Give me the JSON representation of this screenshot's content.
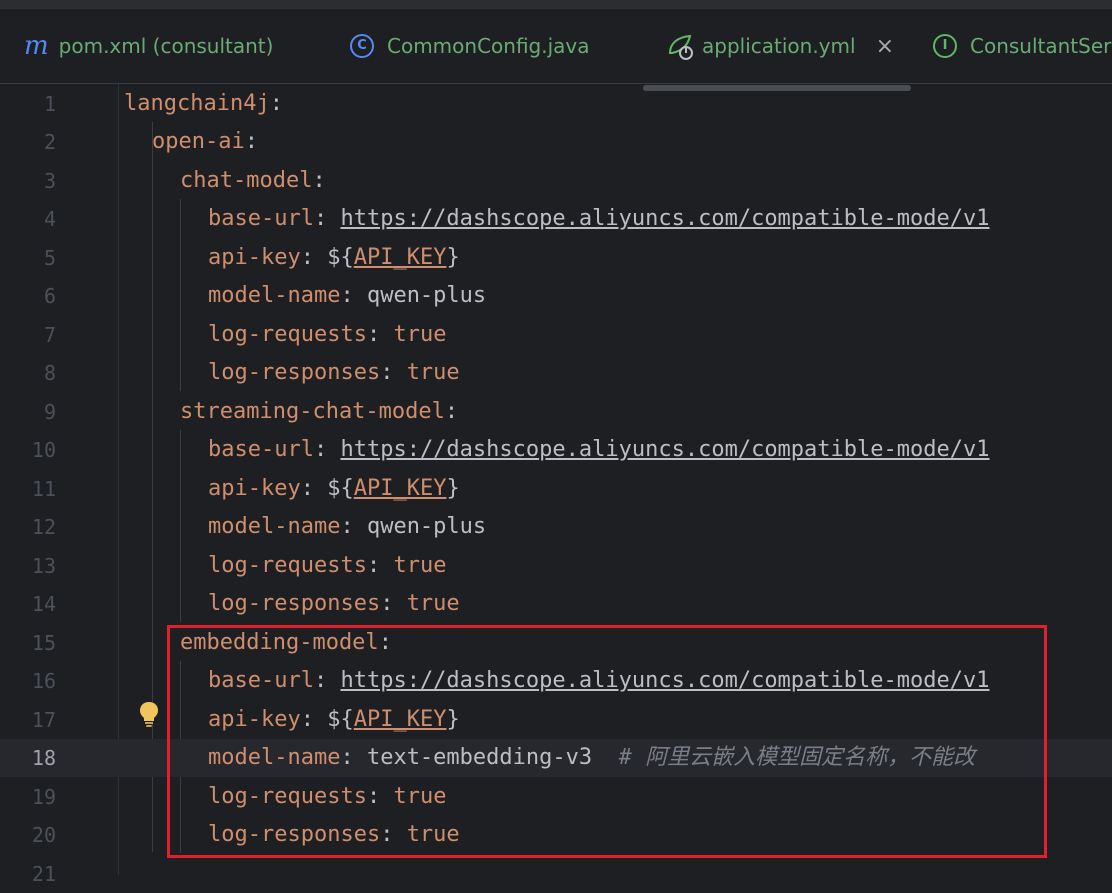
{
  "tabs": [
    {
      "label": "pom.xml (consultant)",
      "icon": "maven-m-icon"
    },
    {
      "label": "CommonConfig.java",
      "icon": "class-c-icon"
    },
    {
      "label": "application.yml",
      "icon": "spring-config-icon",
      "active": true,
      "close": "×"
    },
    {
      "label": "ConsultantService",
      "icon": "interface-i-icon"
    }
  ],
  "editor": {
    "current_line": 18,
    "line_numbers": [
      "1",
      "2",
      "3",
      "4",
      "5",
      "6",
      "7",
      "8",
      "9",
      "10",
      "11",
      "12",
      "13",
      "14",
      "15",
      "16",
      "17",
      "18",
      "19",
      "20",
      "21"
    ],
    "lines": [
      {
        "key": "langchain4j",
        "sep": ":"
      },
      {
        "key": "open-ai",
        "sep": ":"
      },
      {
        "key": "chat-model",
        "sep": ":"
      },
      {
        "key": "base-url",
        "sep": ":",
        "value": "https://dashscope.aliyuncs.com/compatible-mode/v1"
      },
      {
        "key": "api-key",
        "sep": ":",
        "value_prefix": "${",
        "value_var": "API_KEY",
        "value_suffix": "}"
      },
      {
        "key": "model-name",
        "sep": ":",
        "value": "qwen-plus"
      },
      {
        "key": "log-requests",
        "sep": ":",
        "value": "true"
      },
      {
        "key": "log-responses",
        "sep": ":",
        "value": "true"
      },
      {
        "key": "streaming-chat-model",
        "sep": ":"
      },
      {
        "key": "base-url",
        "sep": ":",
        "value": "https://dashscope.aliyuncs.com/compatible-mode/v1"
      },
      {
        "key": "api-key",
        "sep": ":",
        "value_prefix": "${",
        "value_var": "API_KEY",
        "value_suffix": "}"
      },
      {
        "key": "model-name",
        "sep": ":",
        "value": "qwen-plus"
      },
      {
        "key": "log-requests",
        "sep": ":",
        "value": "true"
      },
      {
        "key": "log-responses",
        "sep": ":",
        "value": "true"
      },
      {
        "key": "embedding-model",
        "sep": ":"
      },
      {
        "key": "base-url",
        "sep": ":",
        "value": "https://dashscope.aliyuncs.com/compatible-mode/v1"
      },
      {
        "key": "api-key",
        "sep": ":",
        "value_prefix": "${",
        "value_var": "API_KEY",
        "value_suffix": "}"
      },
      {
        "key": "model-name",
        "sep": ":",
        "value": "text-embedding-v3",
        "comment": "# 阿里云嵌入模型固定名称，不能改"
      },
      {
        "key": "log-requests",
        "sep": ":",
        "value": "true"
      },
      {
        "key": "log-responses",
        "sep": ":",
        "value": "true"
      }
    ]
  },
  "colors": {
    "background": "#1e1f22",
    "key": "#cf8e6d",
    "string": "#bcbec4",
    "comment": "#7a7e85",
    "tab_text": "#6aab73",
    "highlight_box": "#e0202a"
  }
}
